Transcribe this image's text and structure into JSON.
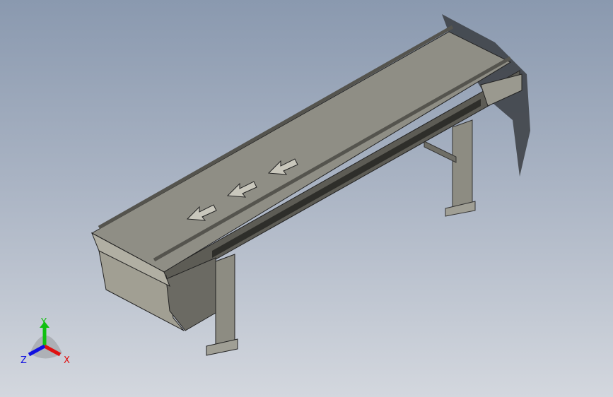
{
  "viewport": {
    "background_top": "#8a99af",
    "background_bottom": "#d3d7de"
  },
  "model": {
    "name_icon": "belt-conveyor-model",
    "arrow_count": 3
  },
  "triad": {
    "x_label": "X",
    "y_label": "Y",
    "z_label": "Z",
    "x_color": "#e01010",
    "y_color": "#10c010",
    "z_color": "#1010e0"
  }
}
